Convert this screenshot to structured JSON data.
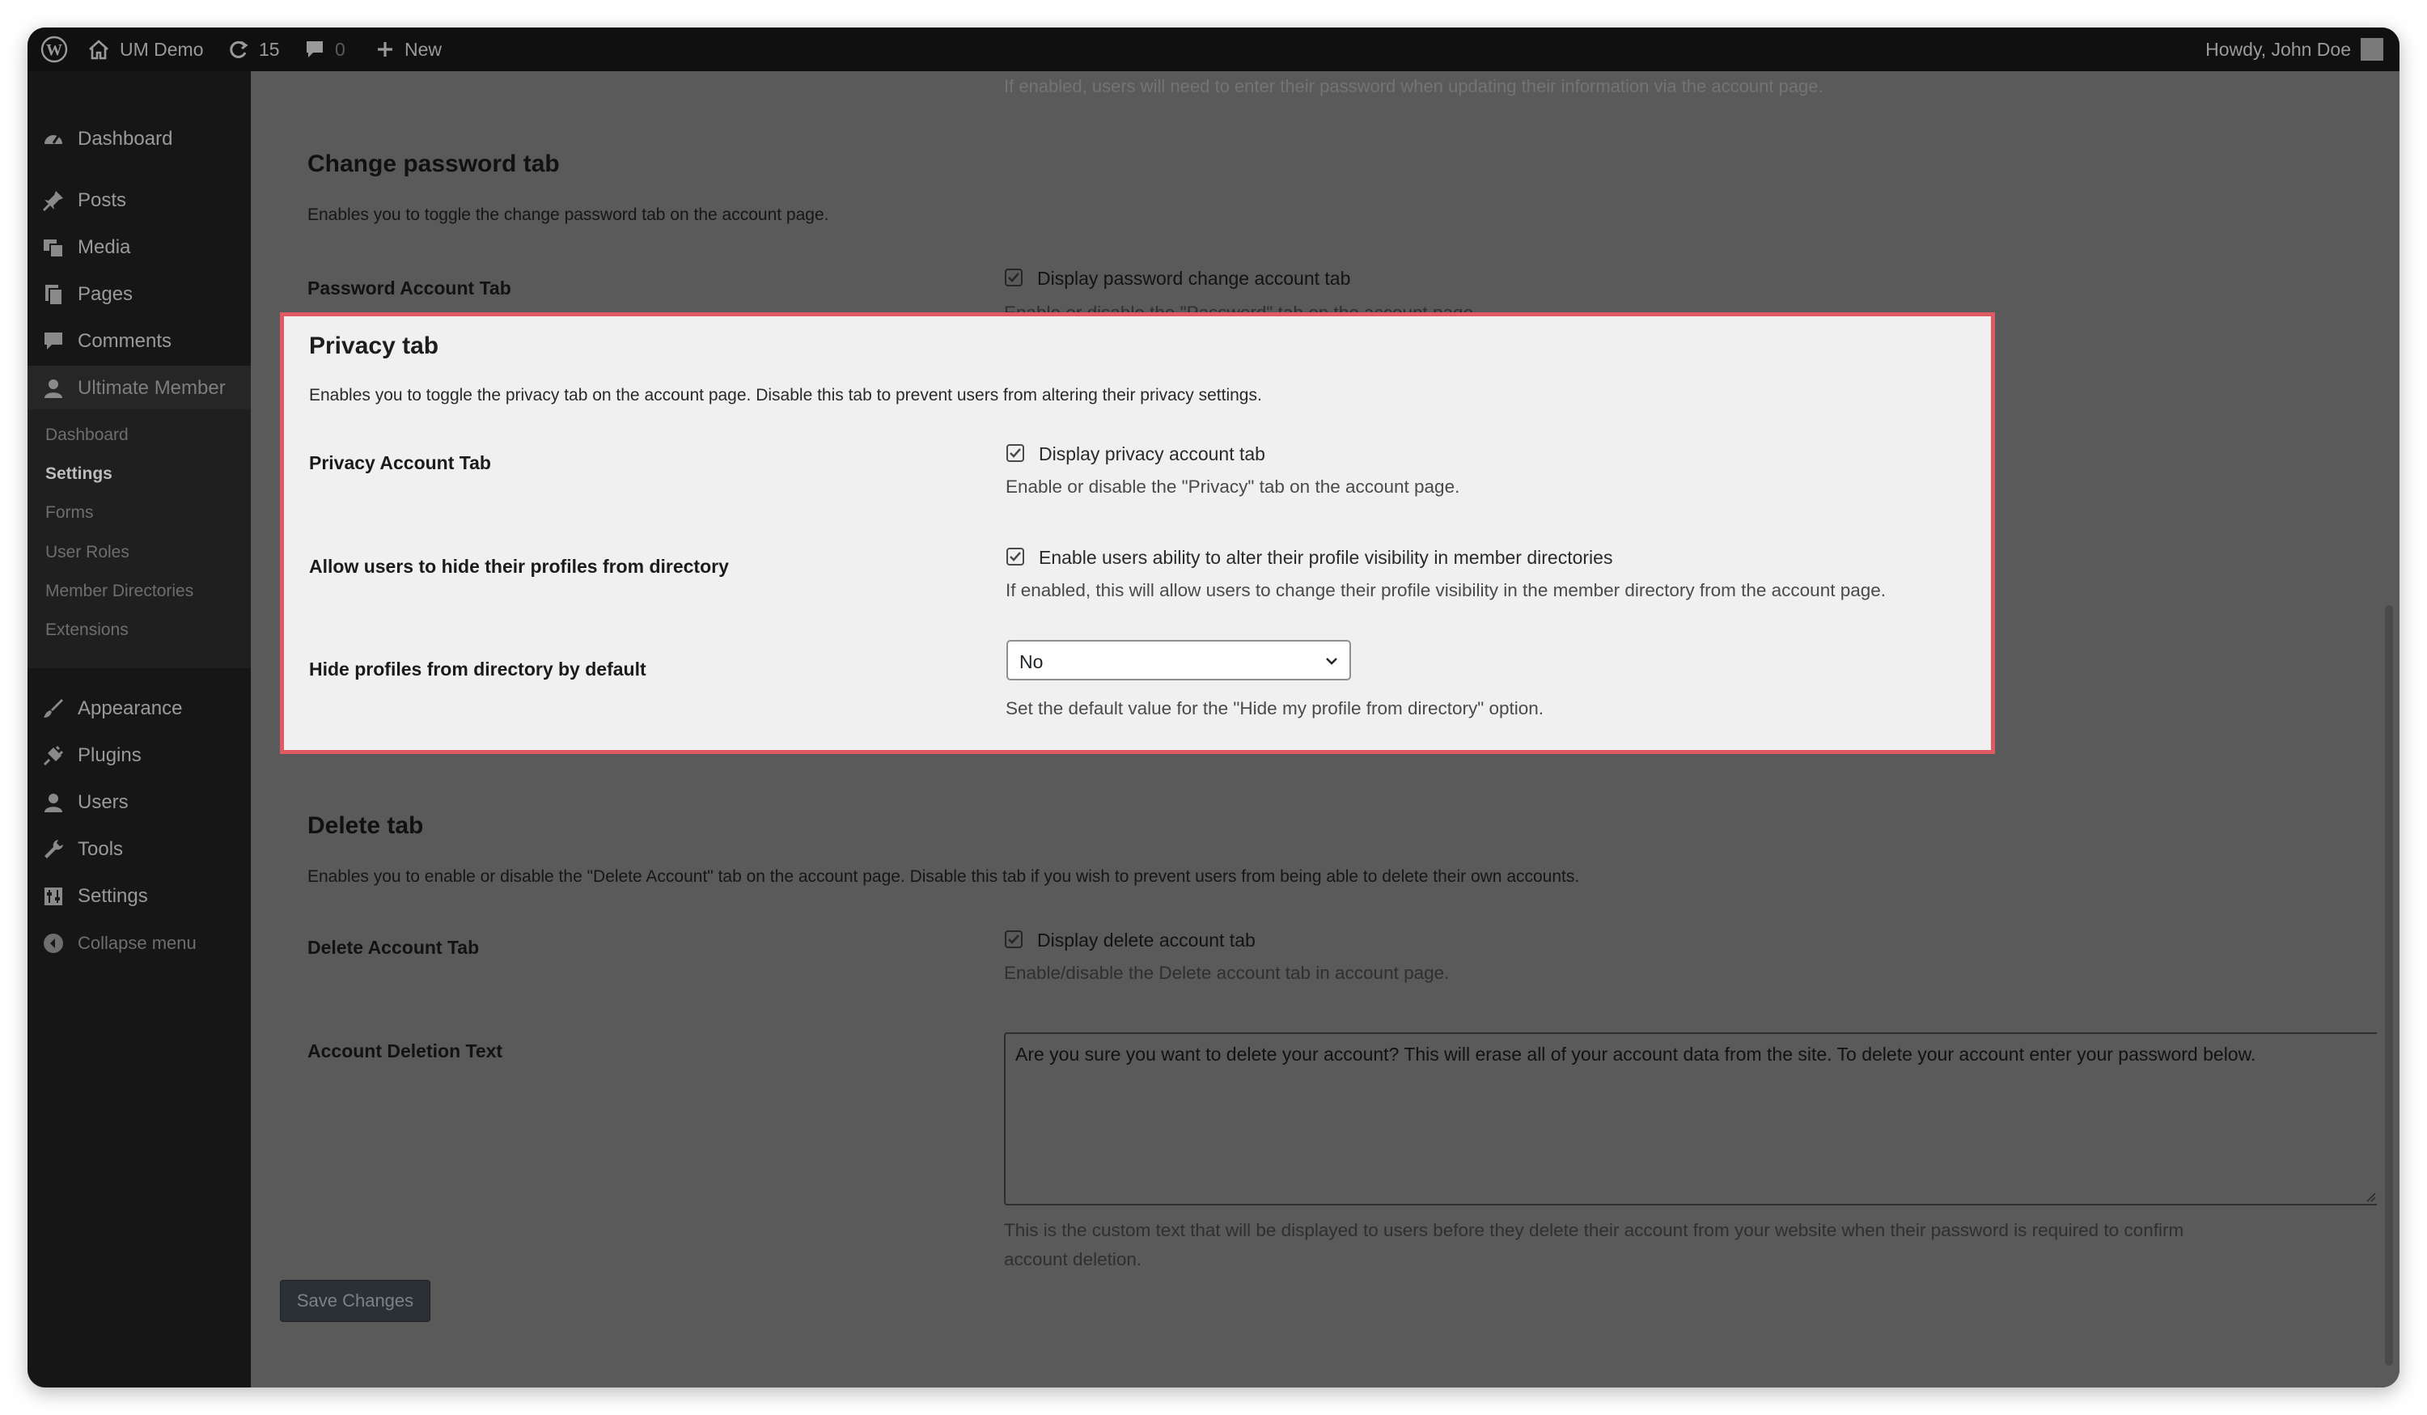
{
  "adminbar": {
    "wp_logo": "wordpress-logo-icon",
    "site_name": "UM Demo",
    "updates_count": "15",
    "comments_count": "0",
    "new_label": "New",
    "howdy": "Howdy, John Doe"
  },
  "sidebar": {
    "items": [
      {
        "label": "Dashboard",
        "icon": "dashboard-icon"
      },
      {
        "label": "Posts",
        "icon": "pin-icon"
      },
      {
        "label": "Media",
        "icon": "media-icon"
      },
      {
        "label": "Pages",
        "icon": "pages-icon"
      },
      {
        "label": "Comments",
        "icon": "comment-icon"
      },
      {
        "label": "Ultimate Member",
        "icon": "user-icon"
      },
      {
        "label": "Appearance",
        "icon": "brush-icon"
      },
      {
        "label": "Plugins",
        "icon": "plugin-icon"
      },
      {
        "label": "Users",
        "icon": "users-icon"
      },
      {
        "label": "Tools",
        "icon": "wrench-icon"
      },
      {
        "label": "Settings",
        "icon": "settings-icon"
      },
      {
        "label": "Collapse menu",
        "icon": "collapse-icon"
      }
    ],
    "submenu": [
      "Dashboard",
      "Settings",
      "Forms",
      "User Roles",
      "Member Directories",
      "Extensions"
    ]
  },
  "content": {
    "clipped_top_text": "If enabled, users will need to enter their password when updating their information via the account page.",
    "change_password": {
      "heading": "Change password tab",
      "description": "Enables you to toggle the change password tab on the account page.",
      "row_label": "Password Account Tab",
      "checkbox_label": "Display password change account tab",
      "help": "Enable or disable the \"Password\" tab on the account page."
    },
    "privacy": {
      "heading": "Privacy tab",
      "description": "Enables you to toggle the privacy tab on the account page. Disable this tab to prevent users from altering their privacy settings.",
      "row1_label": "Privacy Account Tab",
      "row1_checkbox": "Display privacy account tab",
      "row1_help": "Enable or disable the \"Privacy\" tab on the account page.",
      "row2_label": "Allow users to hide their profiles from directory",
      "row2_checkbox": "Enable users ability to alter their profile visibility in member directories",
      "row2_help": "If enabled, this will allow users to change their profile visibility in the member directory from the account page.",
      "row3_label": "Hide profiles from directory by default",
      "row3_select": "No",
      "row3_help": "Set the default value for the \"Hide my profile from directory\" option."
    },
    "delete": {
      "heading": "Delete tab",
      "description": "Enables you to enable or disable the \"Delete Account\" tab on the account page. Disable this tab if you wish to prevent users from being able to delete their own accounts.",
      "row1_label": "Delete Account Tab",
      "row1_checkbox": "Display delete account tab",
      "row1_help": "Enable/disable the Delete account tab in account page.",
      "row2_label": "Account Deletion Text",
      "textarea_value": "Are you sure you want to delete your account? This will erase all of your account data from the site. To delete your account enter your password below.",
      "help_line1": "This is the custom text that will be displayed to users before they delete their account from your website when their password is required to confirm",
      "help_line2": "account deletion."
    },
    "save_label": "Save Changes"
  }
}
